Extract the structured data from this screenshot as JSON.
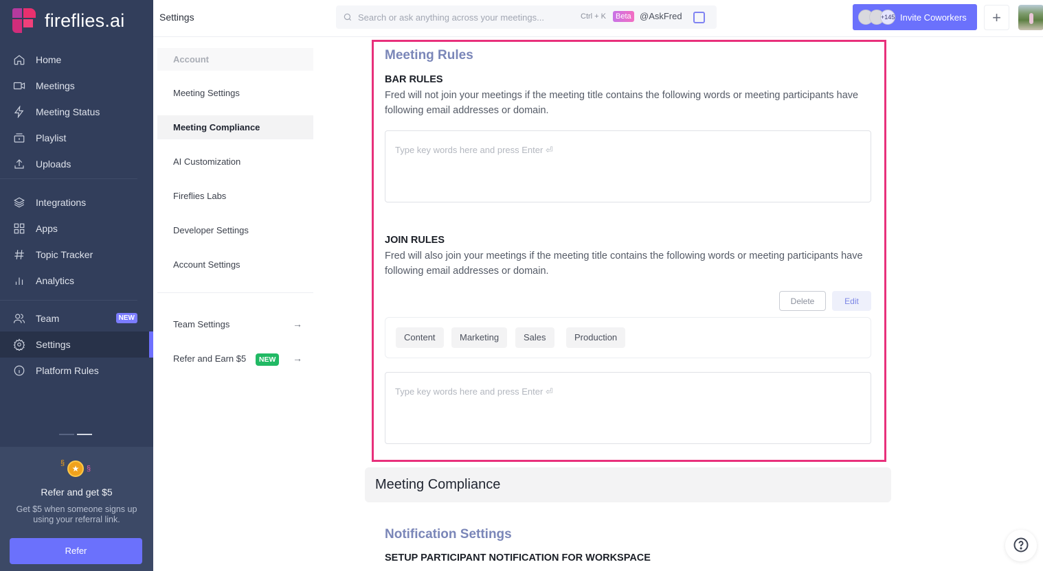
{
  "app": {
    "brand": "fireflies.ai",
    "page_title": "Settings"
  },
  "sidebar": {
    "items": [
      {
        "label": "Home",
        "icon": "home-icon"
      },
      {
        "label": "Meetings",
        "icon": "video-icon"
      },
      {
        "label": "Meeting Status",
        "icon": "lightning-icon"
      },
      {
        "label": "Playlist",
        "icon": "playlist-icon"
      },
      {
        "label": "Uploads",
        "icon": "upload-icon"
      },
      {
        "label": "Integrations",
        "icon": "layers-icon"
      },
      {
        "label": "Apps",
        "icon": "grid-icon"
      },
      {
        "label": "Topic Tracker",
        "icon": "hash-icon"
      },
      {
        "label": "Analytics",
        "icon": "bar-chart-icon"
      },
      {
        "label": "Team",
        "icon": "users-icon",
        "badge": "NEW"
      },
      {
        "label": "Settings",
        "icon": "gear-icon",
        "active": true
      },
      {
        "label": "Platform Rules",
        "icon": "info-icon"
      }
    ],
    "refer": {
      "title": "Refer and get $5",
      "description": "Get $5 when someone signs up using your referral link.",
      "button": "Refer"
    }
  },
  "header": {
    "search_placeholder": "Search or ask anything across your meetings...",
    "shortcut": "Ctrl + K",
    "beta_badge": "Beta",
    "askfred": "@AskFred",
    "invite": {
      "extra_count": "+145",
      "label": "Invite Coworkers"
    },
    "plus": "+"
  },
  "submenu": {
    "group": "Account",
    "items": [
      {
        "label": "Meeting Settings"
      },
      {
        "label": "Meeting Compliance",
        "active": true
      },
      {
        "label": "AI Customization"
      },
      {
        "label": "Fireflies Labs"
      },
      {
        "label": "Developer Settings"
      },
      {
        "label": "Account Settings"
      }
    ],
    "links": [
      {
        "label": "Team Settings",
        "arrow": "→"
      },
      {
        "label": "Refer and Earn $5",
        "badge": "NEW",
        "arrow": "→"
      }
    ]
  },
  "meeting_rules": {
    "title": "Meeting Rules",
    "bar_rules": {
      "heading": "BAR RULES",
      "description": "Fred will not join your meetings if the meeting title contains the following words or meeting participants have following email addresses or domain.",
      "input_placeholder": "Type key words here and press Enter ⏎",
      "input_value": ""
    },
    "join_rules": {
      "heading": "JOIN RULES",
      "description": "Fred will also join your meetings if the meeting title contains the following words or meeting participants have following email addresses or domain.",
      "delete_label": "Delete",
      "edit_label": "Edit",
      "tags": [
        "Content",
        "Marketing",
        "Sales",
        "Production"
      ],
      "input_placeholder": "Type key words here and press Enter ⏎",
      "input_value": ""
    }
  },
  "compliance": {
    "title": "Meeting Compliance"
  },
  "notification": {
    "title": "Notification Settings",
    "subheading": "SETUP PARTICIPANT NOTIFICATION FOR WORKSPACE"
  },
  "colors": {
    "sidebar_bg": "#323e5b",
    "accent": "#6b71fc",
    "highlight_border": "#e8307b",
    "section_title": "#7a86b8",
    "new_badge_green": "#21b964"
  }
}
